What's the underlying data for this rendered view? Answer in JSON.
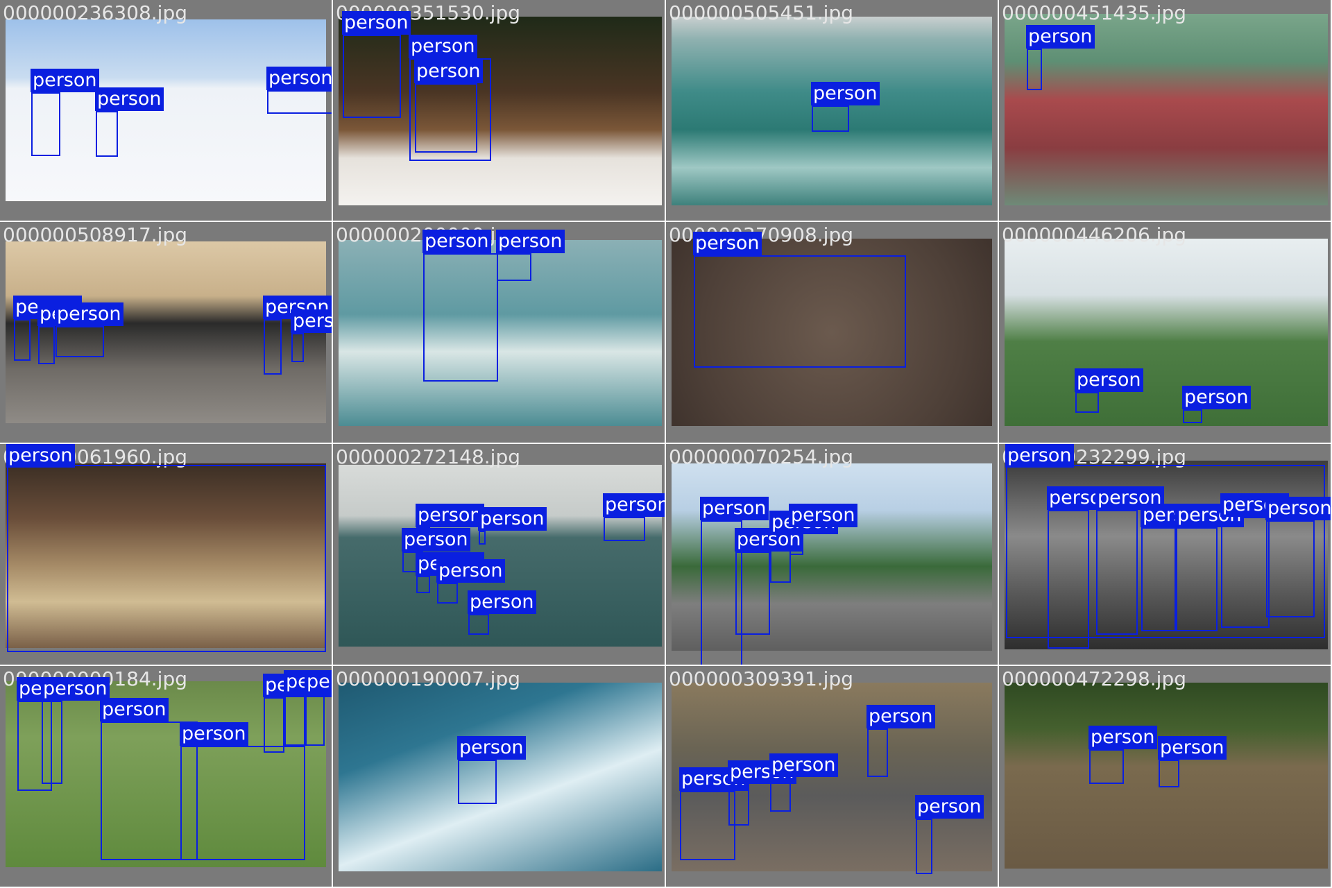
{
  "colors": {
    "box": "#0a1fe0",
    "label_text": "#ffffff",
    "filename_text": "#e6e6e6",
    "frame": "#7a7a7a"
  },
  "class_label": "person",
  "tiles": [
    {
      "filename": "000000236308.jpg",
      "boxes": [
        {
          "l": 45,
          "t": 133,
          "w": 42,
          "h": 92
        },
        {
          "l": 138,
          "t": 160,
          "w": 32,
          "h": 66
        },
        {
          "l": 385,
          "t": 130,
          "w": 100,
          "h": 34
        }
      ]
    },
    {
      "filename": "000000351530.jpg",
      "boxes": [
        {
          "l": 14,
          "t": 50,
          "w": 84,
          "h": 120
        },
        {
          "l": 110,
          "t": 84,
          "w": 118,
          "h": 148
        },
        {
          "l": 118,
          "t": 120,
          "w": 90,
          "h": 100
        }
      ]
    },
    {
      "filename": "000000505451.jpg",
      "boxes": [
        {
          "l": 210,
          "t": 152,
          "w": 54,
          "h": 38
        }
      ]
    },
    {
      "filename": "000000451435.jpg",
      "boxes": [
        {
          "l": 40,
          "t": 70,
          "w": 22,
          "h": 60
        }
      ]
    },
    {
      "filename": "000000508917.jpg",
      "boxes": [
        {
          "l": 20,
          "t": 140,
          "w": 24,
          "h": 60
        },
        {
          "l": 55,
          "t": 150,
          "w": 24,
          "h": 55
        },
        {
          "l": 80,
          "t": 150,
          "w": 70,
          "h": 45
        },
        {
          "l": 380,
          "t": 140,
          "w": 26,
          "h": 80
        },
        {
          "l": 420,
          "t": 160,
          "w": 18,
          "h": 42
        }
      ]
    },
    {
      "filename": "000000200000.jpg",
      "boxes": [
        {
          "l": 130,
          "t": 45,
          "w": 108,
          "h": 185
        },
        {
          "l": 236,
          "t": 45,
          "w": 50,
          "h": 40
        }
      ]
    },
    {
      "filename": "000000370908.jpg",
      "boxes": [
        {
          "l": 40,
          "t": 48,
          "w": 306,
          "h": 162
        }
      ]
    },
    {
      "filename": "000000446206.jpg",
      "boxes": [
        {
          "l": 110,
          "t": 245,
          "w": 34,
          "h": 30
        },
        {
          "l": 265,
          "t": 270,
          "w": 28,
          "h": 20
        }
      ]
    },
    {
      "filename": "000000061960.jpg",
      "boxes": [
        {
          "l": 10,
          "t": 30,
          "w": 460,
          "h": 270
        }
      ]
    },
    {
      "filename": "000000272148.jpg",
      "boxes": [
        {
          "l": 120,
          "t": 120,
          "w": 20,
          "h": 30
        },
        {
          "l": 100,
          "t": 155,
          "w": 30,
          "h": 30
        },
        {
          "l": 120,
          "t": 190,
          "w": 20,
          "h": 25
        },
        {
          "l": 210,
          "t": 125,
          "w": 10,
          "h": 20
        },
        {
          "l": 150,
          "t": 200,
          "w": 30,
          "h": 30
        },
        {
          "l": 195,
          "t": 245,
          "w": 30,
          "h": 30
        },
        {
          "l": 390,
          "t": 105,
          "w": 60,
          "h": 35
        }
      ]
    },
    {
      "filename": "000000070254.jpg",
      "boxes": [
        {
          "l": 50,
          "t": 110,
          "w": 60,
          "h": 240
        },
        {
          "l": 100,
          "t": 155,
          "w": 50,
          "h": 120
        },
        {
          "l": 150,
          "t": 130,
          "w": 30,
          "h": 70
        },
        {
          "l": 178,
          "t": 120,
          "w": 20,
          "h": 40
        }
      ]
    },
    {
      "filename": "000000232299.jpg",
      "boxes": [
        {
          "l": 10,
          "t": 30,
          "w": 460,
          "h": 250
        },
        {
          "l": 70,
          "t": 95,
          "w": 60,
          "h": 200
        },
        {
          "l": 140,
          "t": 95,
          "w": 60,
          "h": 180
        },
        {
          "l": 205,
          "t": 120,
          "w": 50,
          "h": 150
        },
        {
          "l": 255,
          "t": 120,
          "w": 60,
          "h": 150
        },
        {
          "l": 320,
          "t": 105,
          "w": 70,
          "h": 160
        },
        {
          "l": 385,
          "t": 110,
          "w": 70,
          "h": 140
        }
      ]
    },
    {
      "filename": "000000000184.jpg",
      "boxes": [
        {
          "l": 25,
          "t": 50,
          "w": 50,
          "h": 130
        },
        {
          "l": 60,
          "t": 50,
          "w": 30,
          "h": 120
        },
        {
          "l": 145,
          "t": 80,
          "w": 140,
          "h": 200
        },
        {
          "l": 260,
          "t": 115,
          "w": 180,
          "h": 165
        },
        {
          "l": 380,
          "t": 45,
          "w": 30,
          "h": 80
        },
        {
          "l": 410,
          "t": 40,
          "w": 30,
          "h": 75
        },
        {
          "l": 440,
          "t": 40,
          "w": 28,
          "h": 75
        }
      ]
    },
    {
      "filename": "000000190007.jpg",
      "boxes": [
        {
          "l": 180,
          "t": 135,
          "w": 56,
          "h": 64
        }
      ]
    },
    {
      "filename": "000000309391.jpg",
      "boxes": [
        {
          "l": 20,
          "t": 180,
          "w": 80,
          "h": 100
        },
        {
          "l": 90,
          "t": 170,
          "w": 30,
          "h": 60
        },
        {
          "l": 290,
          "t": 90,
          "w": 30,
          "h": 70
        },
        {
          "l": 360,
          "t": 220,
          "w": 24,
          "h": 80
        },
        {
          "l": 150,
          "t": 160,
          "w": 30,
          "h": 50
        }
      ]
    },
    {
      "filename": "000000472298.jpg",
      "boxes": [
        {
          "l": 130,
          "t": 120,
          "w": 50,
          "h": 50
        },
        {
          "l": 230,
          "t": 135,
          "w": 30,
          "h": 40
        }
      ]
    }
  ]
}
